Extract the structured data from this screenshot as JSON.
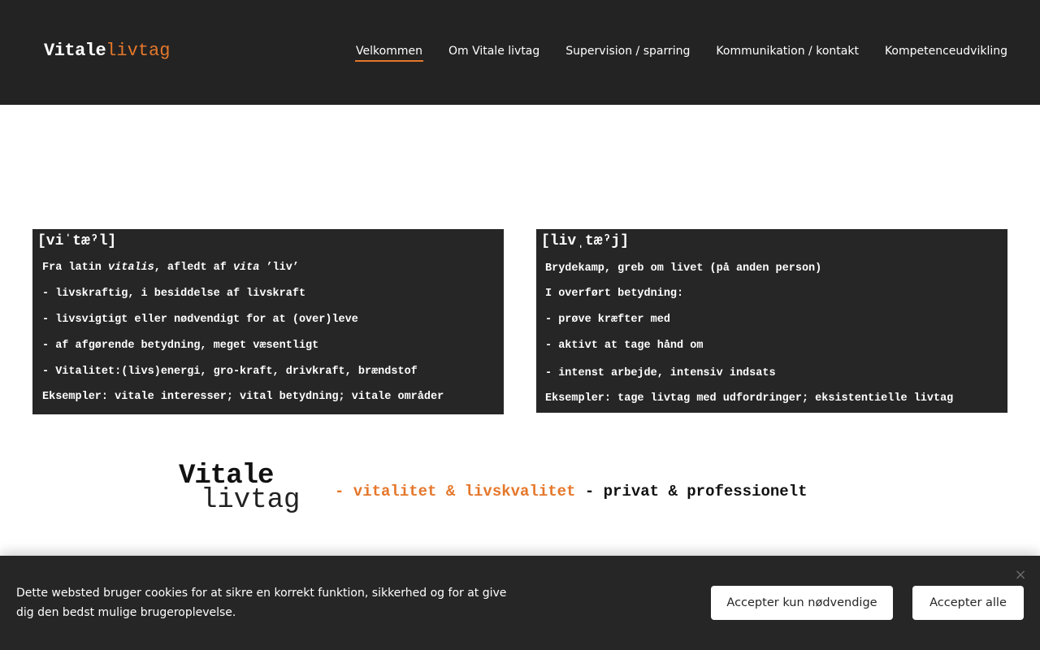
{
  "header": {
    "logo": {
      "part1": "Vitale",
      "part2": "livtag"
    },
    "nav": [
      {
        "label": "Velkommen",
        "active": true
      },
      {
        "label": "Om Vitale livtag",
        "active": false
      },
      {
        "label": "Supervision / sparring",
        "active": false
      },
      {
        "label": "Kommunikation / kontakt",
        "active": false
      },
      {
        "label": "Kompetenceudvikling",
        "active": false
      }
    ]
  },
  "definitions": {
    "vital": {
      "title": "[viˈtæˀl]",
      "line1_prefix": "Fra latin ",
      "line1_italic1": "vitalis",
      "line1_mid": ", afledt af ",
      "line1_italic2": "vita",
      "line1_suffix": " ’liv’",
      "lines": [
        "- livskraftig, i besiddelse af livskraft",
        "- livsvigtigt eller nødvendigt for at (over)leve",
        "- af afgørende betydning, meget væsentligt",
        "- Vitalitet:(livs)energi, gro-kraft, drivkraft, brændstof",
        "Eksempler: vitale interesser; vital betydning; vitale områder"
      ]
    },
    "livtag": {
      "title": "[livˌtæˀj]",
      "lines": [
        "Brydekamp, greb om livet (på anden person)",
        "I overført betydning:",
        "- prøve kræfter med",
        "- aktivt at tage hånd om",
        "- intenst arbejde, intensiv indsats",
        "Eksempler: tage livtag med udfordringer; eksistentielle livtag"
      ]
    }
  },
  "banner": {
    "word1": "Vitale",
    "word2": "livtag",
    "tagline_orange": "- vitalitet & livskvalitet",
    "tagline_dark": " - privat & professionelt"
  },
  "cookie": {
    "text": "Dette websted bruger cookies for at sikre en korrekt funktion, sikkerhed og for at give dig den bedst mulige brugeroplevelse.",
    "close_icon": "×",
    "btn_necessary": "Accepter kun nødvendige",
    "btn_all": "Accepter alle"
  },
  "colors": {
    "header_bg": "#232323",
    "accent": "#e5772b",
    "box_bg": "#262626",
    "cookie_bg": "#262626"
  }
}
